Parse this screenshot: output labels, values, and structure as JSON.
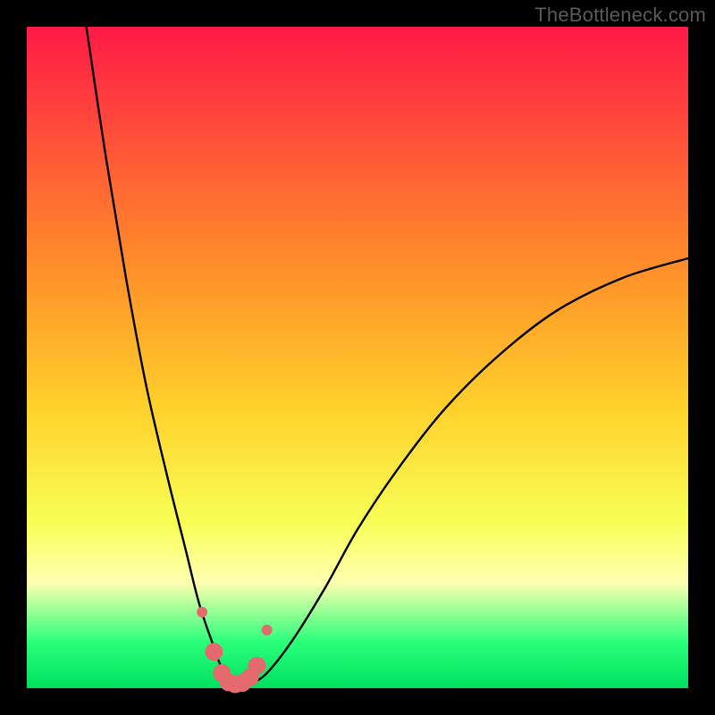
{
  "watermark": "TheBottleneck.com",
  "colors": {
    "frame": "#000000",
    "grad_top": "#ff1a47",
    "grad_upper_mid": "#ff8a2a",
    "grad_mid": "#ffd22b",
    "grad_lower_mid": "#f7ff57",
    "grad_pale": "#ffffb0",
    "grad_green": "#2bff7a",
    "grad_green_deep": "#00e060",
    "curve_stroke": "#000000",
    "marker_fill": "#e46a6e",
    "marker_stroke": "#e46a6e"
  },
  "gradient_stops": [
    {
      "pct": 0,
      "key": "grad_top"
    },
    {
      "pct": 35,
      "key": "grad_upper_mid"
    },
    {
      "pct": 58,
      "key": "grad_mid"
    },
    {
      "pct": 75,
      "key": "grad_lower_mid"
    },
    {
      "pct": 84,
      "key": "grad_pale"
    },
    {
      "pct": 93,
      "key": "grad_green"
    },
    {
      "pct": 100,
      "key": "grad_green_deep"
    }
  ],
  "chart_data": {
    "type": "line",
    "title": "",
    "xlabel": "",
    "ylabel": "",
    "xlim": [
      0,
      100
    ],
    "ylim": [
      0,
      100
    ],
    "note": "Axes are unlabeled; values estimated from pixel positions on a 0–100 normalized grid. y=0 is bottom edge, y=100 is top edge.",
    "series": [
      {
        "name": "bottleneck-curve",
        "x": [
          9,
          12,
          15,
          18,
          21,
          24,
          26,
          28,
          29.5,
          31,
          33,
          36,
          40,
          45,
          50,
          56,
          63,
          71,
          80,
          90,
          100
        ],
        "y": [
          100,
          80,
          62,
          46,
          33,
          21,
          13,
          7,
          3,
          1,
          0.5,
          2,
          7,
          15,
          24,
          33,
          42,
          50,
          57,
          62,
          65
        ]
      }
    ],
    "markers": {
      "name": "highlight-dots",
      "x": [
        26.5,
        28.3,
        29.5,
        30.5,
        31.5,
        32.6,
        33.7,
        34.8,
        36.3
      ],
      "y": [
        11.5,
        5.5,
        2.3,
        0.9,
        0.6,
        0.8,
        1.6,
        3.4,
        8.8
      ],
      "size_small": 6,
      "size_large": 10,
      "large_indices": [
        1,
        2,
        3,
        4,
        5,
        6,
        7
      ]
    }
  }
}
